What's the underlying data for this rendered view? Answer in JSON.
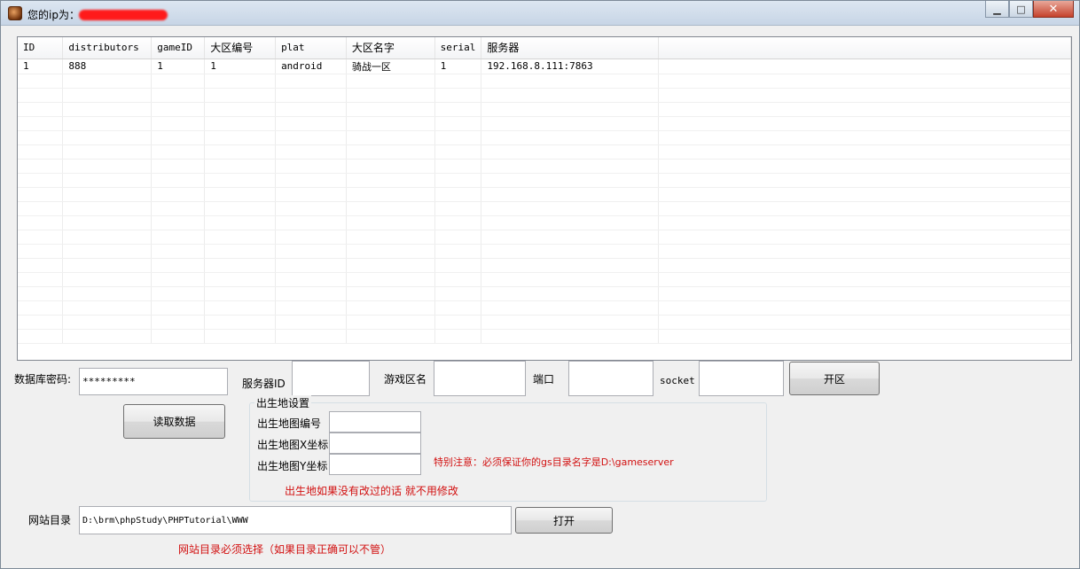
{
  "window": {
    "title": "您的ip为：",
    "controls": {
      "minimize": "▁",
      "maximize": "□",
      "close": "✕"
    }
  },
  "grid": {
    "columns": [
      "ID",
      "distributors",
      "gameID",
      "大区编号",
      "plat",
      "大区名字",
      "serial",
      "服务器"
    ],
    "rows": [
      [
        "1",
        "888",
        "1",
        "1",
        "android",
        "骑战一区",
        "1",
        "192.168.8.111:7863"
      ]
    ]
  },
  "form": {
    "db_password_label": "数据库密码:",
    "db_password_value": "*********",
    "server_id_label": "服务器ID",
    "server_id_value": "",
    "zone_name_label": "游戏区名",
    "zone_name_value": "",
    "port_label": "端口",
    "port_value": "",
    "socket_label": "socket",
    "socket_value": "",
    "open_zone_button": "开区",
    "read_data_button": "读取数据",
    "spawn_group_title": "出生地设置",
    "spawn_map_id_label": "出生地图编号",
    "spawn_map_id_value": "",
    "spawn_x_label": "出生地图X坐标",
    "spawn_x_value": "",
    "spawn_y_label": "出生地图Y坐标",
    "spawn_y_value": "",
    "special_note": "特别注意：必须保证你的gs目录名字是D:\\gameserver",
    "spawn_note": "出生地如果没有改过的话 就不用修改",
    "web_dir_label": "网站目录",
    "web_dir_value": "D:\\brm\\phpStudy\\PHPTutorial\\WWW",
    "open_button": "打开",
    "web_dir_note": "网站目录必须选择（如果目录正确可以不管）"
  },
  "colors": {
    "warning": "#d21010",
    "title_bar": "#c7d5e6"
  }
}
